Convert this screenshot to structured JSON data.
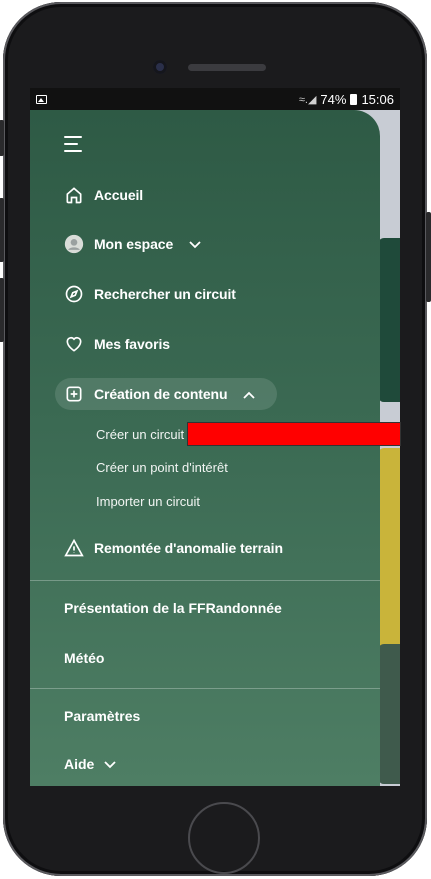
{
  "statusbar": {
    "signal": "≈.◢",
    "battery_pct": "74%",
    "time": "15:06",
    "left_icon": "image-notification-icon"
  },
  "drawer": {
    "menu_icon": "hamburger-menu-icon",
    "items": [
      {
        "label": "Accueil",
        "icon": "home-icon"
      },
      {
        "label": "Mon espace",
        "icon": "avatar"
      },
      {
        "label": "Rechercher un circuit",
        "icon": "compass-icon"
      },
      {
        "label": "Mes favoris",
        "icon": "heart-icon"
      },
      {
        "label": "Création de contenu",
        "icon": "plus-square-icon"
      }
    ],
    "sub_items": [
      "Créer un circuit",
      "Créer un point d'intérêt",
      "Importer un circuit"
    ],
    "report": {
      "label": "Remontée d'anomalie terrain",
      "icon": "warning-icon"
    },
    "sections": [
      "Présentation de la FFRandonnée",
      "Météo",
      "Paramètres",
      "Aide"
    ]
  },
  "colors": {
    "drawer_top": "#2e5a45",
    "drawer_bottom": "#4e7e64",
    "highlight": "#ff0000"
  }
}
